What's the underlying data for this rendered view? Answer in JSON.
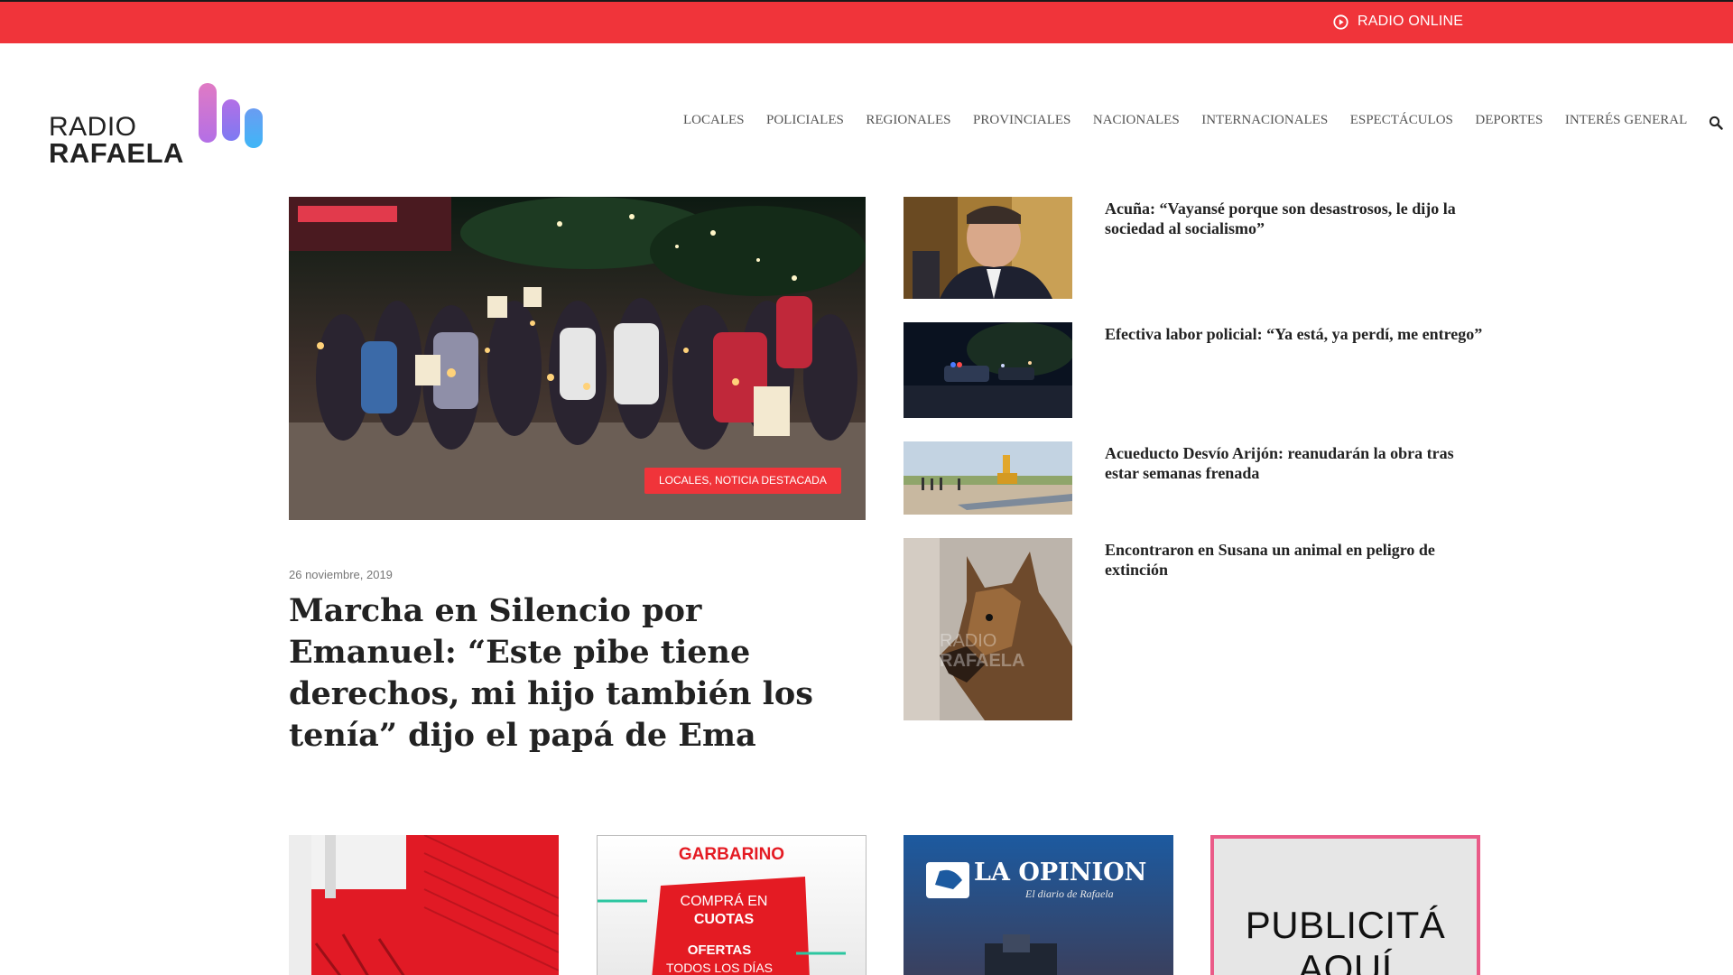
{
  "topbar": {
    "radio_label": "RADIO ONLINE",
    "bg_color": "#f0343a"
  },
  "logo": {
    "line1": "RADIO",
    "line2": "RAFAELA",
    "bar_colors": [
      "#c36cd8",
      "#8a7cf0",
      "#4ab0f5"
    ]
  },
  "nav": {
    "items": [
      "LOCALES",
      "POLICIALES",
      "REGIONALES",
      "PROVINCIALES",
      "NACIONALES",
      "INTERNACIONALES",
      "ESPECTÁCULOS",
      "DEPORTES",
      "INTERÉS GENERAL"
    ],
    "search_icon": "search-icon"
  },
  "featured": {
    "category": "LOCALES, NOTICIA DESTACADA",
    "date": "26 noviembre, 2019",
    "title": "Marcha en Silencio por Emanuel: “Este pibe tiene derechos, mi hijo también los tenía” dijo el papá de Ema"
  },
  "side_news": [
    {
      "title": "Acuña: “Vayansé porque son desastrosos, le dijo la sociedad al socialismo”"
    },
    {
      "title": "Efectiva labor policial: “Ya está, ya perdí, me entrego”"
    },
    {
      "title": "Acueducto Desvío Arijón: reanudarán la obra tras estar semanas frenada"
    },
    {
      "title": "Encontraron en Susana un animal en peligro de extinción"
    }
  ],
  "ads": {
    "garbarino": {
      "brand": "GARBARINO",
      "line1": "COMPRÁ EN",
      "line2": "CUOTAS",
      "line3": "OFERTAS",
      "line4": "TODOS LOS DÍAS"
    },
    "la_opinion": {
      "brand": "LA OPINION",
      "tagline": "El diario de Rafaela"
    },
    "publicita": {
      "line1": "PUBLICITÁ",
      "line2": "AQUÍ"
    },
    "watermark_1": "RADIO",
    "watermark_2": "RAFAELA"
  },
  "colors": {
    "accent": "#f0343a",
    "text": "#222222",
    "muted": "#777777"
  }
}
